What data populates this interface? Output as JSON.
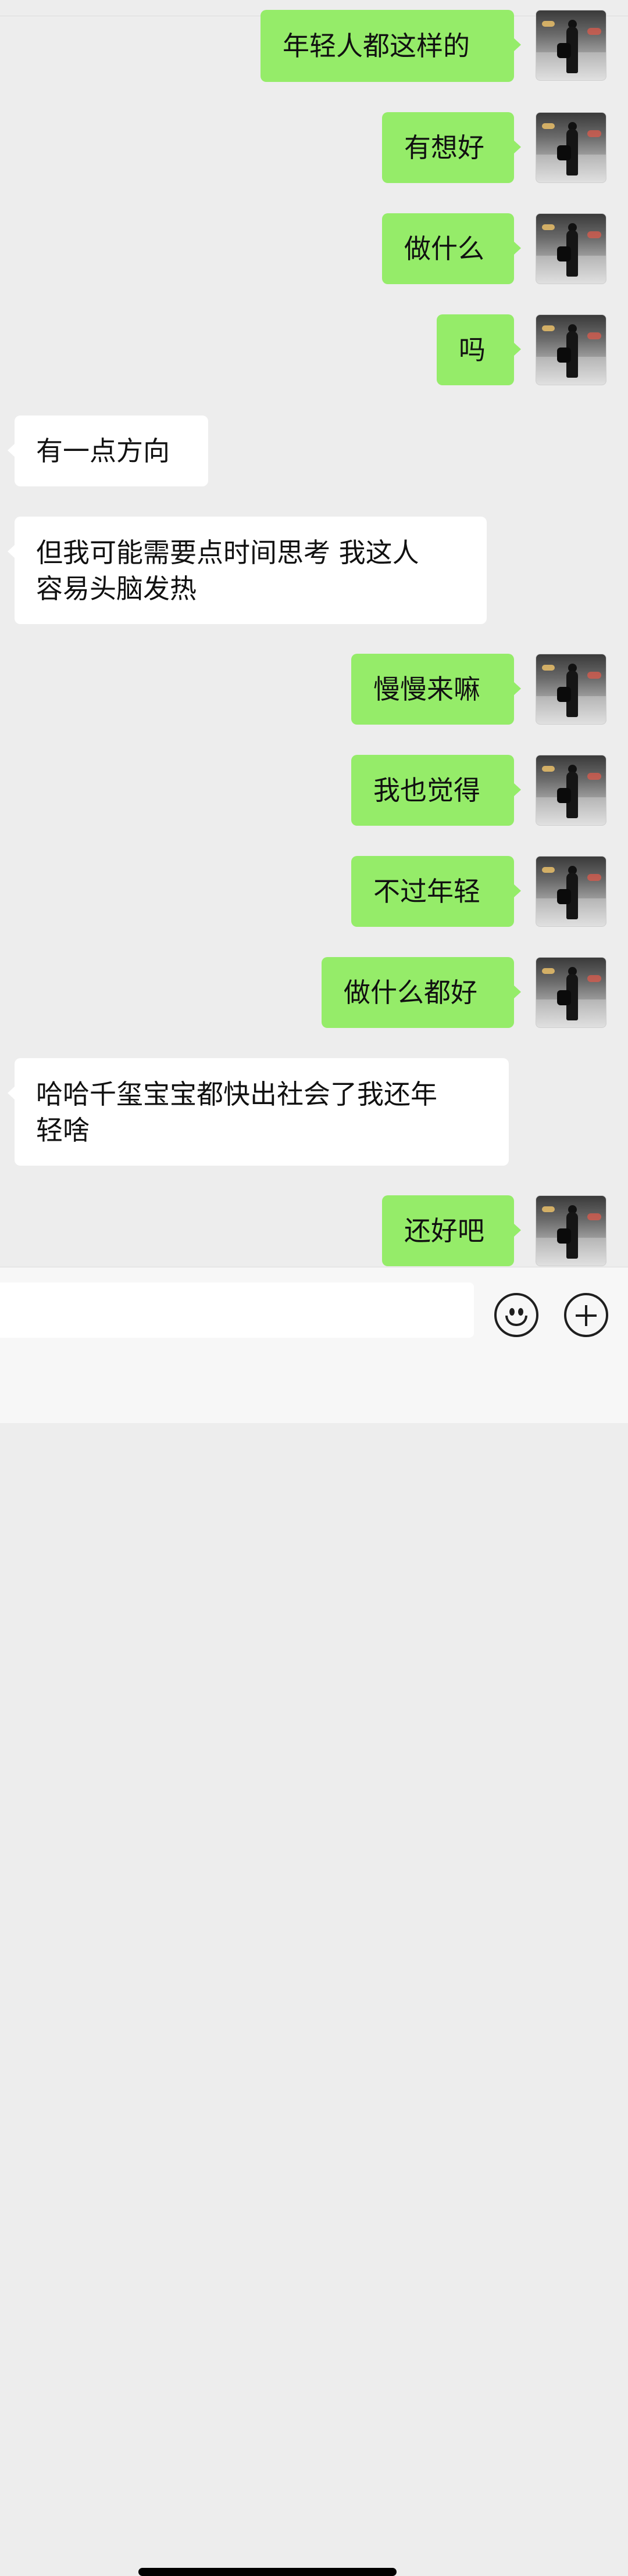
{
  "messages": [
    {
      "side": "me",
      "text": "年轻人都这样的"
    },
    {
      "side": "me",
      "text": "有想好"
    },
    {
      "side": "me",
      "text": "做什么"
    },
    {
      "side": "me",
      "text": "吗"
    },
    {
      "side": "them",
      "text": "有一点方向"
    },
    {
      "side": "them",
      "text": "但我可能需要点时间思考 我这人\n容易头脑发热"
    },
    {
      "side": "me",
      "text": "慢慢来嘛"
    },
    {
      "side": "me",
      "text": "我也觉得"
    },
    {
      "side": "me",
      "text": "不过年轻"
    },
    {
      "side": "me",
      "text": "做什么都好"
    },
    {
      "side": "them",
      "text": "哈哈千玺宝宝都快出社会了我还年\n轻啥"
    },
    {
      "side": "me",
      "text": "还好吧"
    }
  ],
  "input_bar": {
    "value": "",
    "emoji_icon": "smiley-icon",
    "plus_icon": "plus-icon"
  },
  "colors": {
    "sent_bubble": "#95ec69",
    "received_bubble": "#ffffff",
    "background": "#ededed"
  }
}
